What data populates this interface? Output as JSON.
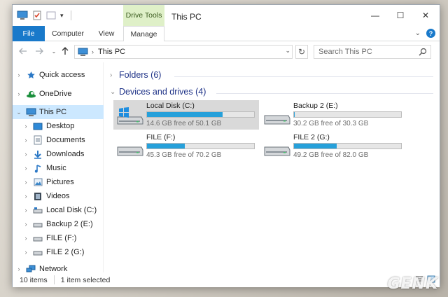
{
  "window": {
    "title": "This PC",
    "context_tab": "Drive Tools",
    "controls": {
      "minimize": "—",
      "maximize": "☐",
      "close": "✕"
    }
  },
  "ribbon": {
    "tabs": [
      {
        "label": "File"
      },
      {
        "label": "Computer"
      },
      {
        "label": "View"
      },
      {
        "label": "Manage"
      }
    ]
  },
  "address": {
    "back_icon": "arrow-left-icon",
    "forward_icon": "arrow-right-icon",
    "up_icon": "arrow-up-icon",
    "path": "This PC",
    "search_placeholder": "Search This PC"
  },
  "nav": {
    "items": [
      {
        "label": "Quick access",
        "icon": "star-icon"
      },
      {
        "label": "OneDrive",
        "icon": "onedrive-icon"
      },
      {
        "label": "This PC",
        "icon": "computer-icon",
        "selected": true
      },
      {
        "label": "Desktop",
        "icon": "desktop-icon"
      },
      {
        "label": "Documents",
        "icon": "documents-icon"
      },
      {
        "label": "Downloads",
        "icon": "downloads-icon"
      },
      {
        "label": "Music",
        "icon": "music-icon"
      },
      {
        "label": "Pictures",
        "icon": "pictures-icon"
      },
      {
        "label": "Videos",
        "icon": "videos-icon"
      },
      {
        "label": "Local Disk (C:)",
        "icon": "drive-icon"
      },
      {
        "label": "Backup 2 (E:)",
        "icon": "drive-icon"
      },
      {
        "label": "FILE (F:)",
        "icon": "drive-icon"
      },
      {
        "label": "FILE 2 (G:)",
        "icon": "drive-icon"
      },
      {
        "label": "Network",
        "icon": "network-icon"
      }
    ]
  },
  "content": {
    "folders_group": "Folders (6)",
    "devices_group": "Devices and drives (4)",
    "drives": [
      {
        "name": "Local Disk (C:)",
        "free_text": "14.6 GB free of 50.1 GB",
        "used_fraction": 0.709,
        "selected": true,
        "windows": true
      },
      {
        "name": "Backup 2 (E:)",
        "free_text": "30.2 GB free of 30.3 GB",
        "used_fraction": 0.003,
        "selected": false,
        "windows": false
      },
      {
        "name": "FILE (F:)",
        "free_text": "45.3 GB free of 70.2 GB",
        "used_fraction": 0.355,
        "selected": false,
        "windows": false
      },
      {
        "name": "FILE 2 (G:)",
        "free_text": "49.2 GB free of 82.0 GB",
        "used_fraction": 0.4,
        "selected": false,
        "windows": false
      }
    ]
  },
  "status": {
    "count": "10 items",
    "selection": "1 item selected"
  },
  "watermark": "GENK",
  "colors": {
    "accent": "#1979ca",
    "selection": "#cce8ff",
    "progress": "#26a0da",
    "group_text": "#1e3287"
  }
}
